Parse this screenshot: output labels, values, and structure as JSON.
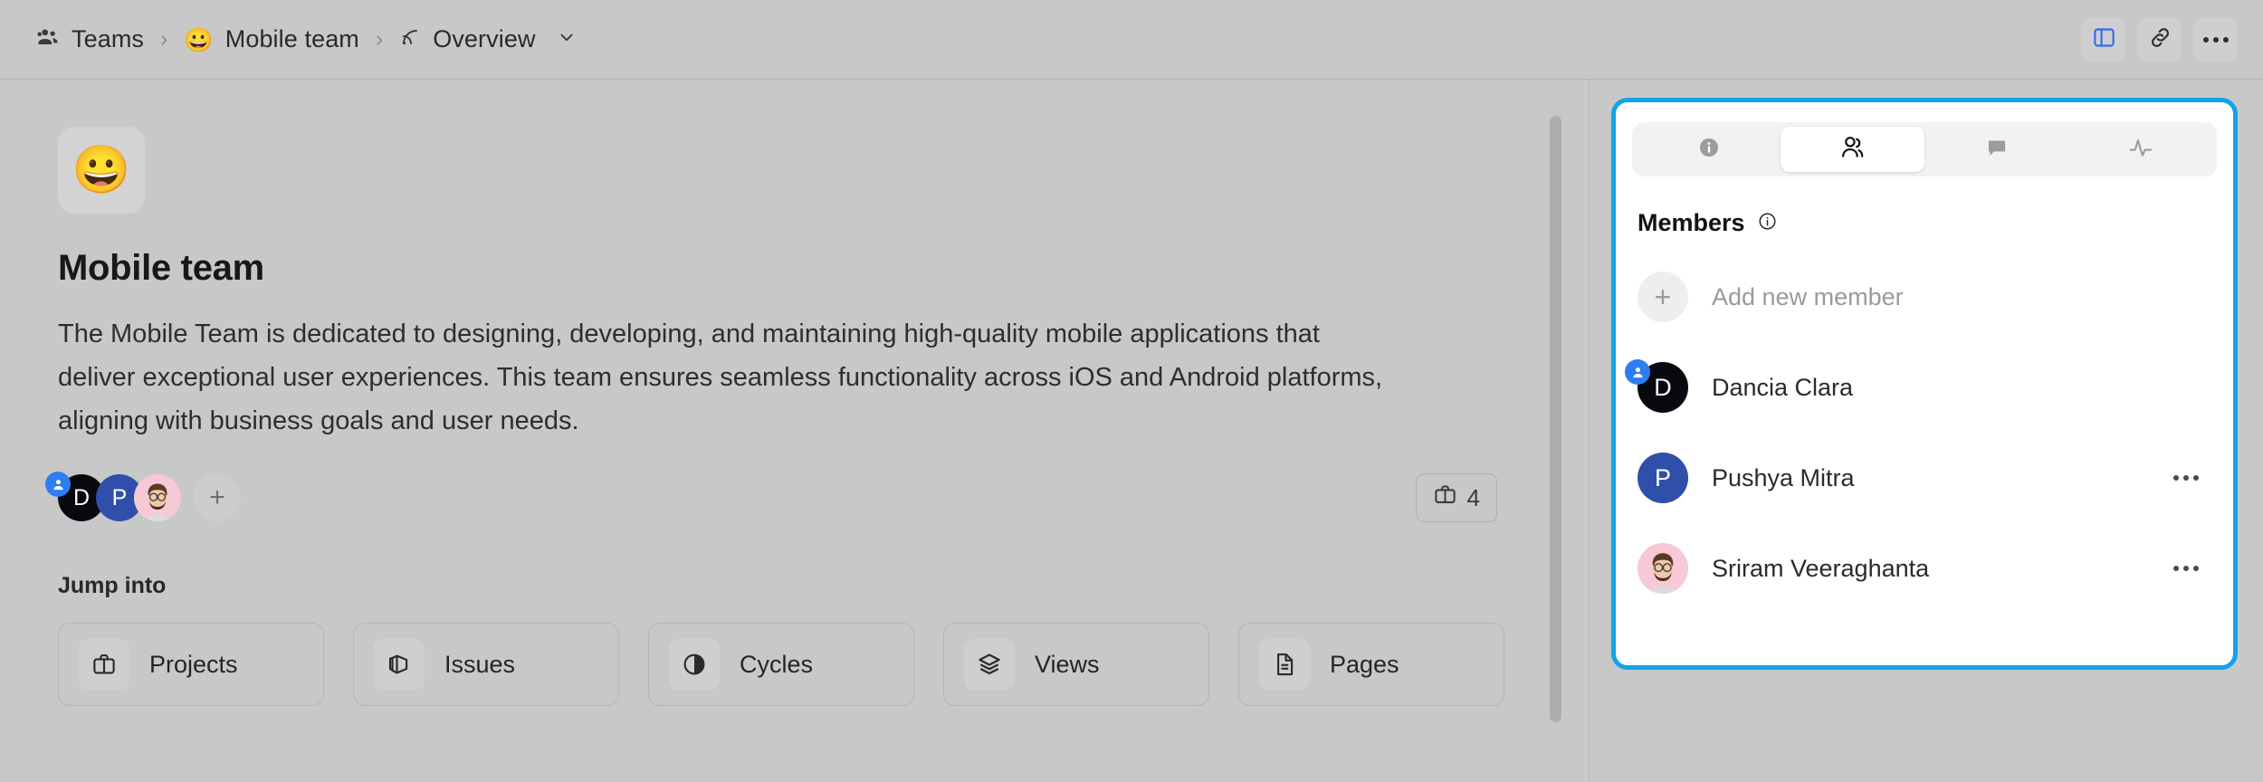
{
  "colors": {
    "highlight": "#12a3e8",
    "accent_blue": "#2f7df4",
    "avatar_dark": "#08080f",
    "avatar_blue": "#2f4faa",
    "page_bg": "#c8c8c8",
    "panel_bg": "#ffffff"
  },
  "header": {
    "breadcrumb": [
      {
        "label": "Teams",
        "icon": "people-group-icon"
      },
      {
        "label": "Mobile team",
        "emoji": "😀"
      },
      {
        "label": "Overview",
        "icon": "rss-broadcast-icon"
      }
    ],
    "separator": "›",
    "actions": [
      {
        "name": "toggle-sidebar-button",
        "icon": "panel-layout-icon"
      },
      {
        "name": "copy-link-button",
        "icon": "link-icon"
      },
      {
        "name": "more-options-button",
        "icon": "ellipsis-icon"
      }
    ]
  },
  "main": {
    "emoji": "😀",
    "title": "Mobile team",
    "description": "The Mobile Team is dedicated to designing, developing, and maintaining high-quality mobile applications that deliver exceptional user experiences. This team ensures seamless functionality across iOS and Android platforms, aligning with business goals and user needs.",
    "avatar_stack": [
      {
        "type": "initial",
        "initial": "D",
        "color": "#08080f",
        "lead": true
      },
      {
        "type": "initial",
        "initial": "P",
        "color": "#2f4faa",
        "lead": false
      },
      {
        "type": "photo",
        "initial": "",
        "color": "#f7c9d6",
        "lead": false
      }
    ],
    "add_member_symbol": "+",
    "project_count": "4",
    "project_count_icon": "briefcase-icon",
    "jump_into_title": "Jump into",
    "jump_cards": [
      {
        "label": "Projects",
        "icon": "briefcase-icon"
      },
      {
        "label": "Issues",
        "icon": "layers-stack-icon"
      },
      {
        "label": "Cycles",
        "icon": "contrast-circle-icon"
      },
      {
        "label": "Views",
        "icon": "stacked-layers-icon"
      },
      {
        "label": "Pages",
        "icon": "document-icon"
      }
    ]
  },
  "panel": {
    "tabs": [
      {
        "name": "tab-info",
        "icon": "info-filled-icon",
        "active": false
      },
      {
        "name": "tab-members",
        "icon": "people-icon",
        "active": true
      },
      {
        "name": "tab-comments",
        "icon": "chat-bubble-icon",
        "active": false
      },
      {
        "name": "tab-activity",
        "icon": "activity-pulse-icon",
        "active": false
      }
    ],
    "section_title": "Members",
    "section_info_icon": "info-outline-icon",
    "add_new_member_label": "Add new member",
    "add_new_member_symbol": "+",
    "members": [
      {
        "name": "Dancia Clara",
        "avatar_type": "initial",
        "initial": "D",
        "color": "#08080f",
        "lead": true,
        "has_menu": false
      },
      {
        "name": "Pushya Mitra",
        "avatar_type": "initial",
        "initial": "P",
        "color": "#2f4faa",
        "lead": false,
        "has_menu": true
      },
      {
        "name": "Sriram Veeraghanta",
        "avatar_type": "photo",
        "initial": "",
        "color": "#f7c9d6",
        "lead": false,
        "has_menu": true
      }
    ]
  }
}
